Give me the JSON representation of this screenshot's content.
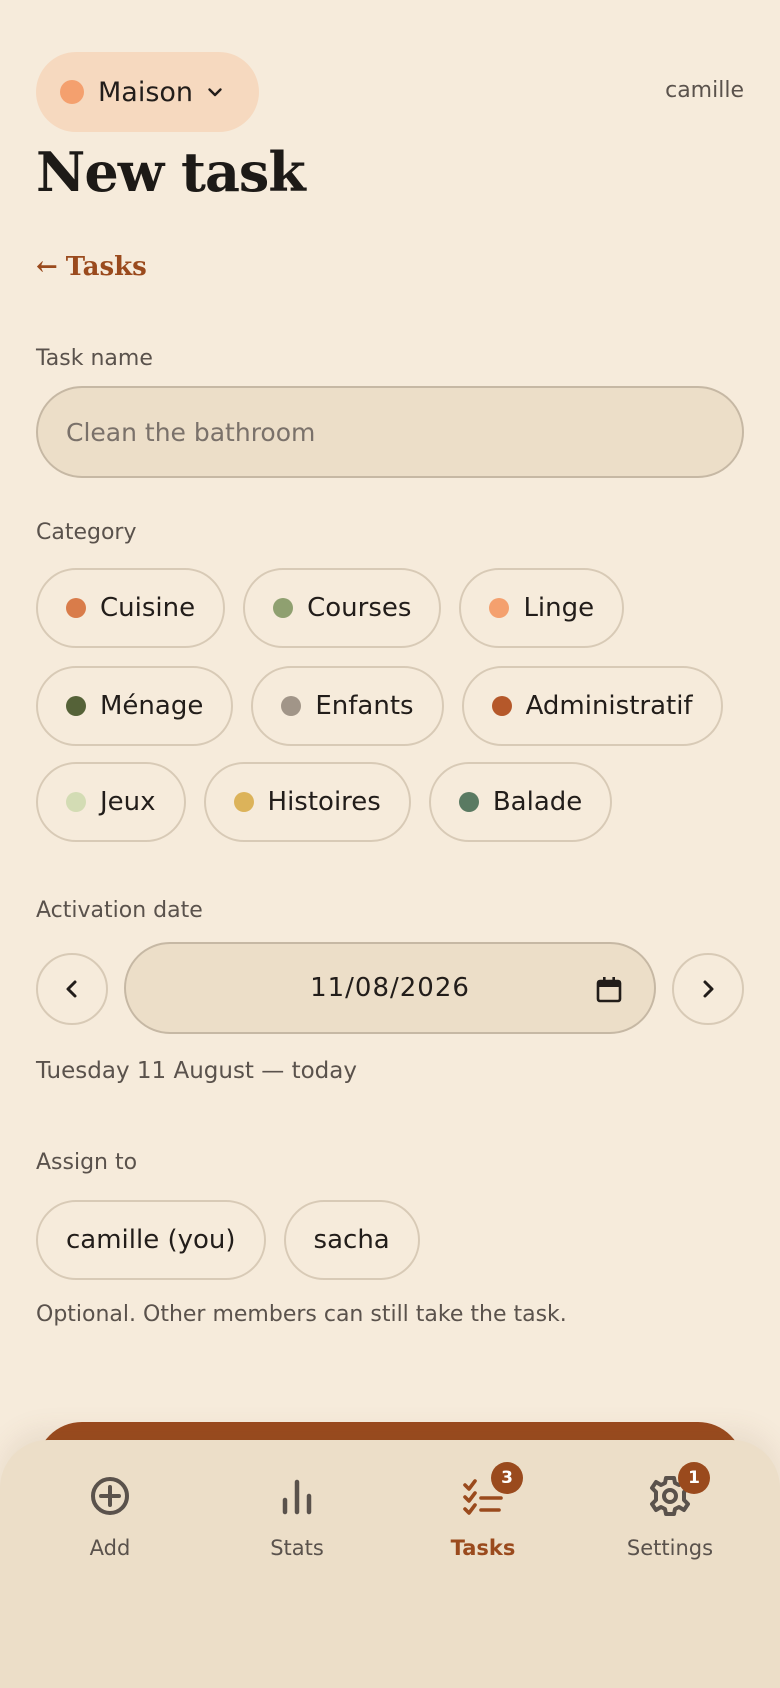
{
  "header": {
    "household": "Maison",
    "household_color": "#f4a06e",
    "user": "camille"
  },
  "page": {
    "title": "New task",
    "back_arrow": "←",
    "back_label": "Tasks"
  },
  "task_name": {
    "label": "Task name",
    "placeholder": "Clean the bathroom",
    "value": ""
  },
  "category": {
    "label": "Category",
    "options": [
      {
        "label": "Cuisine",
        "color": "#d97c4a"
      },
      {
        "label": "Courses",
        "color": "#8fa070"
      },
      {
        "label": "Linge",
        "color": "#f4a06e"
      },
      {
        "label": "Ménage",
        "color": "#556238"
      },
      {
        "label": "Enfants",
        "color": "#a19588"
      },
      {
        "label": "Administratif",
        "color": "#b5582a"
      },
      {
        "label": "Jeux",
        "color": "#d3dcb4"
      },
      {
        "label": "Histoires",
        "color": "#dcb35a"
      },
      {
        "label": "Balade",
        "color": "#5a7a62"
      }
    ]
  },
  "activation": {
    "label": "Activation date",
    "date": "11/08/2026",
    "caption": "Tuesday 11 August — today",
    "prev_icon": "chevron-left-icon",
    "next_icon": "chevron-right-icon",
    "calendar_icon": "calendar-icon"
  },
  "assign": {
    "label": "Assign to",
    "members": [
      "camille (you)",
      "sacha"
    ],
    "hint": "Optional. Other members can still take the task."
  },
  "nav": {
    "items": [
      {
        "label": "Add",
        "icon": "plus-circle-icon"
      },
      {
        "label": "Stats",
        "icon": "bar-chart-icon"
      },
      {
        "label": "Tasks",
        "icon": "checklist-icon",
        "badge": "3",
        "active": true
      },
      {
        "label": "Settings",
        "icon": "gear-icon",
        "badge": "1"
      }
    ]
  },
  "colors": {
    "accent": "#9a4a1d",
    "background": "#f6ebdb"
  }
}
